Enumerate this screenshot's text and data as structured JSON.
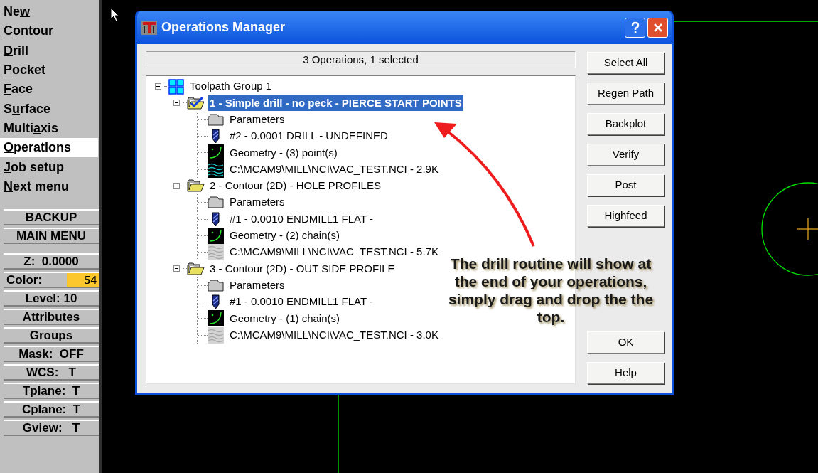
{
  "sidebar": {
    "menu": [
      {
        "pre": "Ne",
        "key": "w",
        "selected": false
      },
      {
        "key": "C",
        "post": "ontour",
        "selected": false
      },
      {
        "key": "D",
        "post": "rill",
        "selected": false
      },
      {
        "key": "P",
        "post": "ocket",
        "selected": false
      },
      {
        "key": "F",
        "post": "ace",
        "selected": false
      },
      {
        "pre": "S",
        "key": "u",
        "post": "rface",
        "selected": false
      },
      {
        "pre": "Multi",
        "key": "a",
        "post": "xis",
        "selected": false
      },
      {
        "key": "O",
        "post": "perations",
        "selected": true
      },
      {
        "key": "J",
        "post": "ob setup",
        "selected": false
      },
      {
        "key": "N",
        "post": "ext menu",
        "selected": false
      }
    ],
    "nav_buttons": [
      "BACKUP",
      "MAIN MENU"
    ],
    "status_buttons": [
      {
        "kind": "button",
        "label": "Z:  0.0000"
      },
      {
        "kind": "swatch",
        "label": "Color:",
        "value": "54",
        "color": "#fcc72c"
      },
      {
        "kind": "button",
        "label": "Level: 10"
      },
      {
        "kind": "button",
        "label": "Attributes"
      },
      {
        "kind": "button",
        "label": "Groups"
      },
      {
        "kind": "button",
        "label": "Mask:  OFF"
      },
      {
        "kind": "button",
        "label": "WCS:   T"
      },
      {
        "kind": "button",
        "label": "Tplane:  T"
      },
      {
        "kind": "button",
        "label": "Cplane:  T"
      },
      {
        "kind": "button",
        "label": "Gview:   T"
      }
    ]
  },
  "dialog": {
    "title": "Operations Manager",
    "status": "3 Operations, 1 selected",
    "tree": {
      "label": "Toolpath Group 1",
      "expanded": true,
      "children": [
        {
          "label": "1 - Simple drill - no peck - PIERCE START POINTS",
          "selected": true,
          "expanded": true,
          "children": [
            {
              "kind": "parameters",
              "label": "Parameters"
            },
            {
              "kind": "tool",
              "label": "#2 - 0.0001 DRILL - UNDEFINED"
            },
            {
              "kind": "geometry",
              "label": "Geometry - (3) point(s)"
            },
            {
              "kind": "nci",
              "label": "C:\\MCAM9\\MILL\\NCI\\VAC_TEST.NCI - 2.9K",
              "dimmed": false
            }
          ]
        },
        {
          "label": "2 - Contour (2D) - HOLE PROFILES",
          "selected": false,
          "expanded": true,
          "children": [
            {
              "kind": "parameters",
              "label": "Parameters"
            },
            {
              "kind": "tool",
              "label": "#1 - 0.0010 ENDMILL1 FLAT -"
            },
            {
              "kind": "geometry",
              "label": "Geometry - (2) chain(s)"
            },
            {
              "kind": "nci",
              "label": "C:\\MCAM9\\MILL\\NCI\\VAC_TEST.NCI - 5.7K",
              "dimmed": true
            }
          ]
        },
        {
          "label": "3 - Contour (2D) - OUT SIDE PROFILE",
          "selected": false,
          "expanded": true,
          "children": [
            {
              "kind": "parameters",
              "label": "Parameters"
            },
            {
              "kind": "tool",
              "label": "#1 - 0.0010 ENDMILL1 FLAT -"
            },
            {
              "kind": "geometry",
              "label": "Geometry - (1) chain(s)"
            },
            {
              "kind": "nci",
              "label": "C:\\MCAM9\\MILL\\NCI\\VAC_TEST.NCI - 3.0K",
              "dimmed": true
            }
          ]
        }
      ]
    },
    "buttons_top": [
      "Select All",
      "Regen Path",
      "Backplot",
      "Verify",
      "Post",
      "Highfeed"
    ],
    "buttons_bottom": [
      "OK",
      "Help"
    ]
  },
  "annotation": "The drill routine will show at the end of your operations, simply drag and drop the the top."
}
